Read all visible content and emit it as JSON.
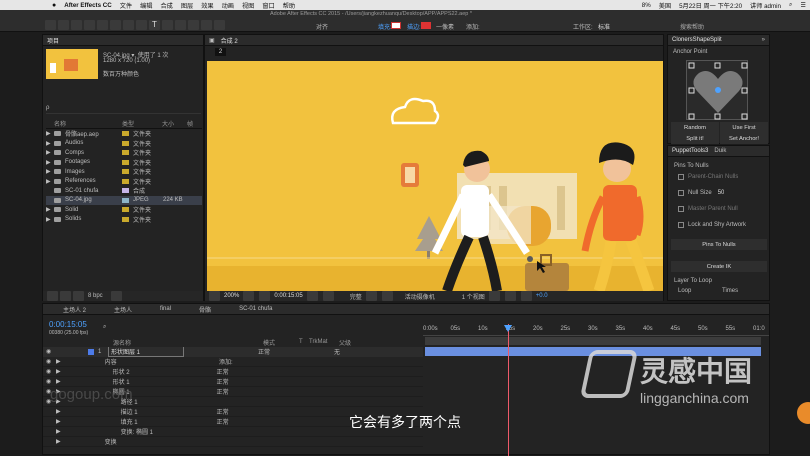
{
  "menubar": {
    "app": "After Effects CC",
    "items": [
      "文件",
      "编辑",
      "合成",
      "图层",
      "效果",
      "动画",
      "视图",
      "窗口",
      "帮助"
    ],
    "status": {
      "battery": "8%",
      "input": "美国",
      "datetime": "5月22日 周一 下午2:20",
      "user": "讲师 admin"
    }
  },
  "window_title": "Adobe After Effects CC 2015 - /Users/jiangkezhuanqu/Desktop/APP/APPS22.aep *",
  "toolbar": {
    "align": "对齐",
    "fill": "填充:",
    "stroke": "描边:",
    "pixels": "一像素",
    "add": "添加:",
    "workspace_label": "工作区:",
    "workspace": "标准",
    "search_placeholder": "搜索帮助"
  },
  "project": {
    "tab": "项目",
    "preview_name": "SC-04.jpg ▾",
    "preview_used": ", 使用了 1 次",
    "preview_size": "1280 x 720 (1.00)",
    "preview_desc": "数百万种颜色",
    "search_placeholder": "ρ",
    "cols": {
      "name": "名称",
      "type": "类型",
      "size": "大小",
      "frame": "帧"
    },
    "items": [
      {
        "name": "骨骼aep.aep",
        "type": "文件夹",
        "size": "",
        "kind": "folder"
      },
      {
        "name": "Audios",
        "type": "文件夹",
        "size": "",
        "kind": "folder"
      },
      {
        "name": "Comps",
        "type": "文件夹",
        "size": "",
        "kind": "folder"
      },
      {
        "name": "Footages",
        "type": "文件夹",
        "size": "",
        "kind": "folder"
      },
      {
        "name": "Images",
        "type": "文件夹",
        "size": "",
        "kind": "folder"
      },
      {
        "name": "References",
        "type": "文件夹",
        "size": "",
        "kind": "folder"
      },
      {
        "name": "SC-01 chufa",
        "type": "合成",
        "size": "",
        "kind": "comp"
      },
      {
        "name": "SC-04.jpg",
        "type": "JPEG",
        "size": "224 KB",
        "kind": "img"
      },
      {
        "name": "Solid",
        "type": "文件夹",
        "size": "",
        "kind": "folder"
      },
      {
        "name": "Solids",
        "type": "文件夹",
        "size": "",
        "kind": "folder"
      }
    ],
    "bpc": "8 bpc"
  },
  "comp": {
    "tab": "合成",
    "tab_name": "合成 2",
    "badge": "2",
    "zoom": "200%",
    "time": "0:00:15:05",
    "quality": "完整",
    "camera": "活动摄像机",
    "views": "1 个视图",
    "exposure": "+0.0"
  },
  "cloners": {
    "title": "ClonersShapeSplit",
    "anchor_label": "Anchor Point",
    "random": "Random",
    "use_first": "Use First",
    "split": "Split it!",
    "set_anchor": "Set Anchor!"
  },
  "puppet": {
    "tab1": "PuppetTools3",
    "tab2": "Duik",
    "pins_to_nulls": "Pins To Nulls",
    "parent_chain": "Parent-Chain Nulls",
    "null_size_label": "Null Size",
    "null_size": "50",
    "master_parent": "Master Parent Null",
    "lock_shy": "Lock and Shy Artwork",
    "pins_btn": "Pins To Nulls",
    "create_ik": "Create IK",
    "layer_to_loop": "Layer To Loop",
    "loop": "Loop",
    "times": "Times"
  },
  "timeline": {
    "tabs": [
      "主场人 2",
      "主场人",
      "final",
      "骨骼",
      "SC-01 chufa"
    ],
    "time": "0:00:15:05",
    "frames": "00380 (25.00 fps)",
    "cols": {
      "source": "源名称",
      "mode": "模式",
      "t": "T",
      "trkmat": "TrkMat",
      "parent": "父级"
    },
    "ruler": [
      "0:00s",
      "05s",
      "10s",
      "15s",
      "20s",
      "25s",
      "30s",
      "35s",
      "40s",
      "45s",
      "50s",
      "55s",
      "01:0"
    ],
    "layer": {
      "num": "1",
      "name": "形状图层 1",
      "mode": "正常",
      "parent": "无"
    },
    "add_label": "添加:",
    "rows": [
      {
        "label": "内容",
        "indent": 1,
        "mode": ""
      },
      {
        "label": "形状 2",
        "indent": 2,
        "mode": "正常"
      },
      {
        "label": "形状 1",
        "indent": 2,
        "mode": "正常"
      },
      {
        "label": "椭圆 1",
        "indent": 2,
        "mode": "正常"
      },
      {
        "label": "路径 1",
        "indent": 3,
        "mode": ""
      },
      {
        "label": "描边 1",
        "indent": 3,
        "mode": "正常"
      },
      {
        "label": "填充 1",
        "indent": 3,
        "mode": "正常"
      },
      {
        "label": "变换: 椭圆 1",
        "indent": 3,
        "mode": ""
      },
      {
        "label": "变换",
        "indent": 1,
        "mode": ""
      }
    ]
  },
  "subtitle": "它会有多了两个点",
  "watermark": {
    "gogo": "gogoup.com",
    "cn": "灵感中国",
    "url": "lingganchina.com"
  }
}
